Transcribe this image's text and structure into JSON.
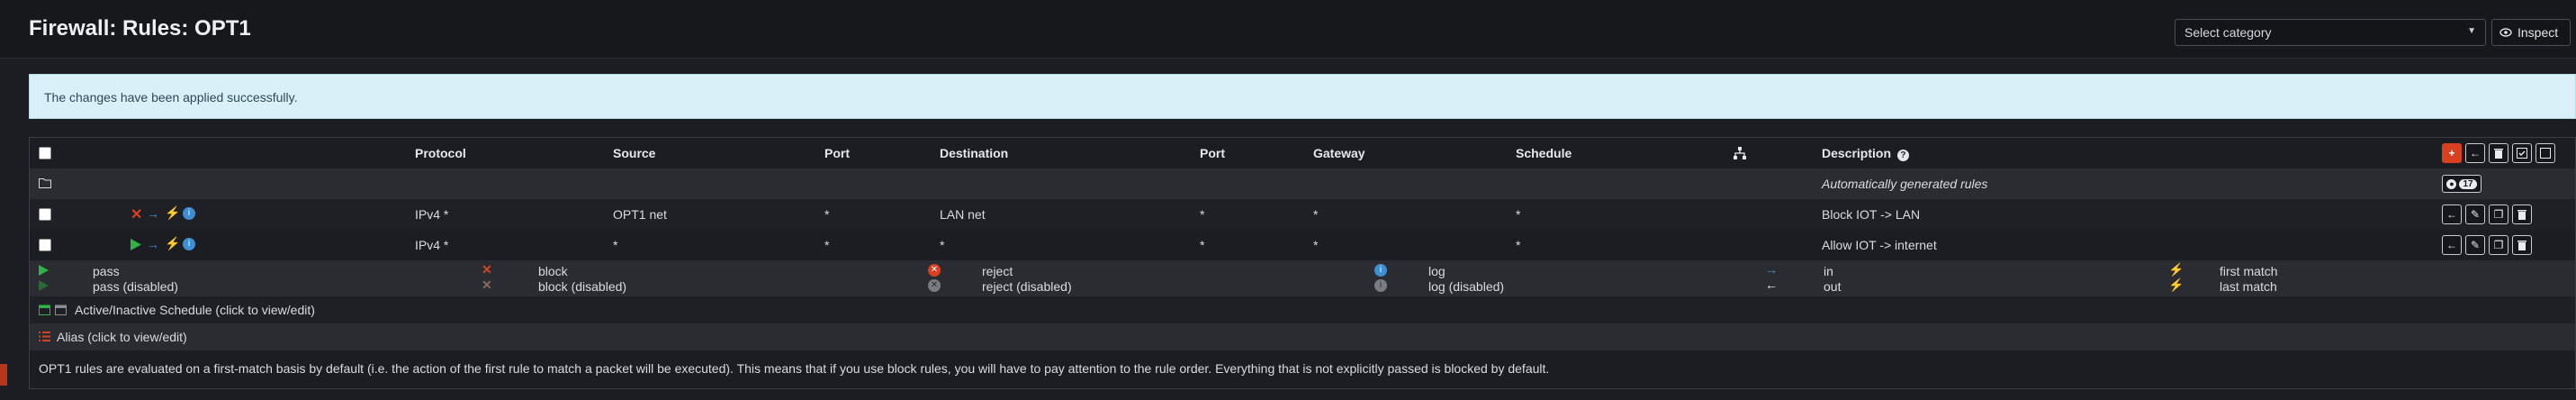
{
  "page": {
    "title": "Firewall: Rules: OPT1"
  },
  "toolbar": {
    "category_placeholder": "Select category",
    "inspect_label": "Inspect"
  },
  "alert": {
    "message": "The changes have been applied successfully."
  },
  "table": {
    "headers": {
      "protocol": "Protocol",
      "source": "Source",
      "port": "Port",
      "destination": "Destination",
      "dport": "Port",
      "gateway": "Gateway",
      "schedule": "Schedule",
      "description": "Description"
    },
    "auto_rules": {
      "label": "Automatically generated rules",
      "count": "17"
    },
    "rows": [
      {
        "action": "block",
        "protocol": "IPv4 *",
        "source": "OPT1 net",
        "port": "*",
        "destination": "LAN net",
        "dport": "*",
        "gateway": "*",
        "schedule": "*",
        "description": "Block IOT -> LAN"
      },
      {
        "action": "pass",
        "protocol": "IPv4 *",
        "source": "*",
        "port": "*",
        "destination": "*",
        "dport": "*",
        "gateway": "*",
        "schedule": "*",
        "description": "Allow IOT -> internet"
      }
    ]
  },
  "legend": {
    "pass": "pass",
    "pass_disabled": "pass (disabled)",
    "block": "block",
    "block_disabled": "block (disabled)",
    "reject": "reject",
    "reject_disabled": "reject (disabled)",
    "log": "log",
    "log_disabled": "log (disabled)",
    "in": "in",
    "out": "out",
    "first_match": "first match",
    "last_match": "last match",
    "schedule": "Active/Inactive Schedule (click to view/edit)",
    "alias": "Alias (click to view/edit)",
    "note": "OPT1 rules are evaluated on a first-match basis by default (i.e. the action of the first rule to match a packet will be executed). This means that if you use block rules, you will have to pay attention to the rule order. Everything that is not explicitly passed is blocked by default."
  },
  "colors": {
    "pass": "#2fb344",
    "block": "#d9401f",
    "accent": "#d9401f",
    "info": "#3d8fd1",
    "lightning": "#f0a020"
  }
}
